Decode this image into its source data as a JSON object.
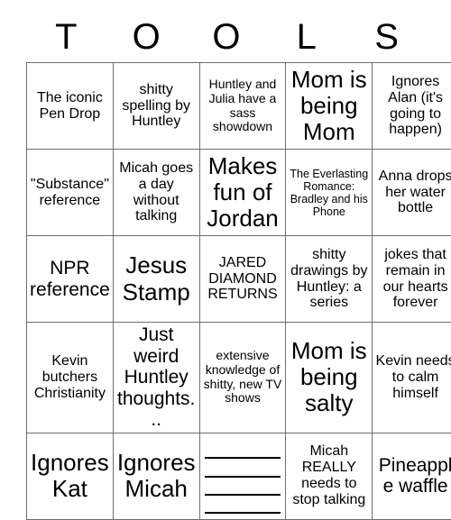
{
  "card": {
    "header_letters": [
      "T",
      "O",
      "O",
      "L",
      "S"
    ],
    "rows": [
      [
        {
          "text": "The iconic Pen Drop",
          "size": "fs-md"
        },
        {
          "text": "shitty spelling by Huntley",
          "size": "fs-md"
        },
        {
          "text": "Huntley and Julia have a sass showdown",
          "size": "fs-sm"
        },
        {
          "text": "Mom is being Mom",
          "size": "fs-xl"
        },
        {
          "text": "Ignores Alan (it's going to happen)",
          "size": "fs-md"
        }
      ],
      [
        {
          "text": "\"Substance\" reference",
          "size": "fs-md"
        },
        {
          "text": "Micah goes a day without talking",
          "size": "fs-md"
        },
        {
          "text": "Makes fun of Jordan",
          "size": "fs-xl"
        },
        {
          "text": "The Everlasting Romance: Bradley and his Phone",
          "size": "fs-xs"
        },
        {
          "text": "Anna drops her water bottle",
          "size": "fs-md"
        }
      ],
      [
        {
          "text": "NPR reference",
          "size": "fs-lg"
        },
        {
          "text": "Jesus Stamp",
          "size": "fs-xl"
        },
        {
          "text": "JARED DIAMOND RETURNS",
          "size": "fs-md"
        },
        {
          "text": "shitty drawings by Huntley: a series",
          "size": "fs-md"
        },
        {
          "text": "jokes that remain in our hearts forever",
          "size": "fs-md"
        }
      ],
      [
        {
          "text": "Kevin butchers Christianity",
          "size": "fs-md"
        },
        {
          "text": "Just weird Huntley thoughts...",
          "size": "fs-lg"
        },
        {
          "text": "extensive knowledge of shitty, new TV shows",
          "size": "fs-sm"
        },
        {
          "text": "Mom is being salty",
          "size": "fs-xl"
        },
        {
          "text": "Kevin needs to calm himself",
          "size": "fs-md"
        }
      ],
      [
        {
          "text": "Ignores Kat",
          "size": "fs-xl"
        },
        {
          "text": "Ignores Micah",
          "size": "fs-xl"
        },
        {
          "text": "",
          "size": "fs-md",
          "blank_lines": 4
        },
        {
          "text": "Micah REALLY needs to stop talking",
          "size": "fs-md"
        },
        {
          "text": "Pineapple waffle",
          "size": "fs-lg"
        }
      ]
    ]
  },
  "colors": {
    "background": "#ffffff",
    "text": "#000000",
    "grid_border": "#6e6e6e",
    "write_in_line": "#000000"
  }
}
